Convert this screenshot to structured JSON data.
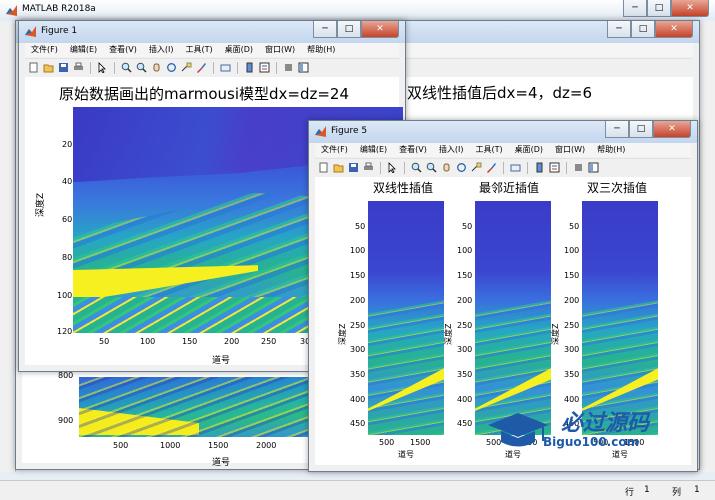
{
  "main_window": {
    "title": "MATLAB R2018a",
    "status": {
      "row_label": "行",
      "row_value": "1",
      "col_label": "列",
      "col_value": "1"
    }
  },
  "menus": [
    "文件(F)",
    "编辑(E)",
    "查看(V)",
    "插入(I)",
    "工具(T)",
    "桌面(D)",
    "窗口(W)",
    "帮助(H)"
  ],
  "figure1": {
    "title": "Figure 1",
    "plot_title": "原始数据画出的marmousi模型dx=dz=24",
    "ylabel": "深度Z",
    "xlabel": "道号",
    "yticks": [
      "20",
      "40",
      "60",
      "80",
      "100",
      "120"
    ],
    "xticks": [
      "50",
      "100",
      "150",
      "200",
      "250",
      "300"
    ]
  },
  "figure_back": {
    "plot_title_partial": "双线性插值后dx=4，dz=6",
    "yticks": [
      "800",
      "900"
    ],
    "xticks": [
      "500",
      "1000",
      "1500",
      "2000",
      "2"
    ],
    "xlabel": "道号"
  },
  "figure5": {
    "title": "Figure 5",
    "subplots": [
      {
        "title": "双线性插值",
        "ylabel": "深度Z",
        "xlabel": "道号",
        "yticks": [
          "50",
          "100",
          "150",
          "200",
          "250",
          "300",
          "350",
          "400",
          "450"
        ],
        "xticks": [
          "500",
          "1500"
        ]
      },
      {
        "title": "最邻近插值",
        "ylabel": "深度Z",
        "xlabel": "道号",
        "yticks": [
          "50",
          "100",
          "150",
          "200",
          "250",
          "300",
          "350",
          "400",
          "450"
        ],
        "xticks": [
          "500",
          "1500"
        ]
      },
      {
        "title": "双三次插值",
        "ylabel": "深度Z",
        "xlabel": "道号",
        "yticks": [
          "50",
          "100",
          "150",
          "200",
          "250",
          "300",
          "350",
          "400",
          "450"
        ],
        "xticks": [
          "500",
          "1500"
        ]
      }
    ]
  },
  "watermark": {
    "cn": "必过源码",
    "url": "Biguo100.com"
  },
  "colors": {
    "deep_blue": "#3b3cc7",
    "blue": "#3577d9",
    "cyan": "#22a8c8",
    "green": "#28b68c",
    "yellow": "#f7f020",
    "titlebar": "#c3d6ee"
  }
}
